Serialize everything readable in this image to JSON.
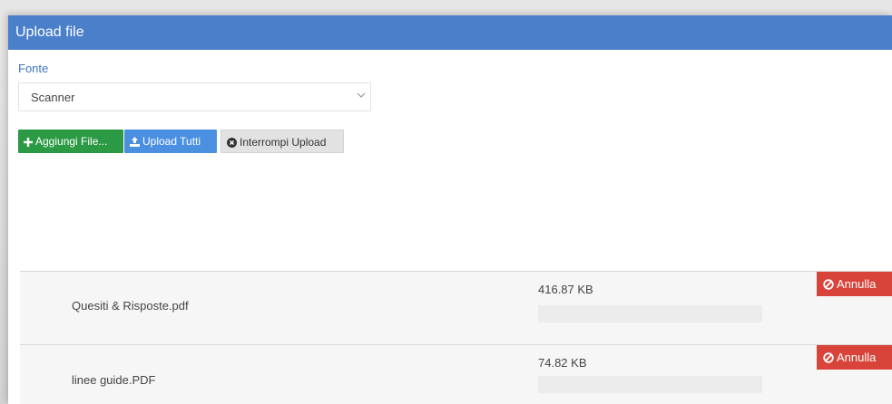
{
  "dialog": {
    "title": "Upload file"
  },
  "source": {
    "label": "Fonte",
    "selected": "Scanner"
  },
  "toolbar": {
    "add_label": "Aggiungi File...",
    "upload_all_label": "Upload Tutti",
    "stop_label": "Interrompi Upload"
  },
  "files": [
    {
      "name": "Quesiti & Risposte.pdf",
      "size": "416.87 KB",
      "progress": 0,
      "cancel_label": "Annulla"
    },
    {
      "name": "linee guide.PDF",
      "size": "74.82 KB",
      "progress": 0,
      "cancel_label": "Annulla"
    }
  ],
  "colors": {
    "header": "#4a7fca",
    "add_button": "#2c9a45",
    "upload_button": "#4a8fe0",
    "cancel_button": "#d9443a"
  },
  "icons": {
    "add": "plus-icon",
    "upload": "upload-icon",
    "stop": "times-circle-icon",
    "cancel": "ban-icon",
    "dropdown": "chevron-down-icon"
  }
}
